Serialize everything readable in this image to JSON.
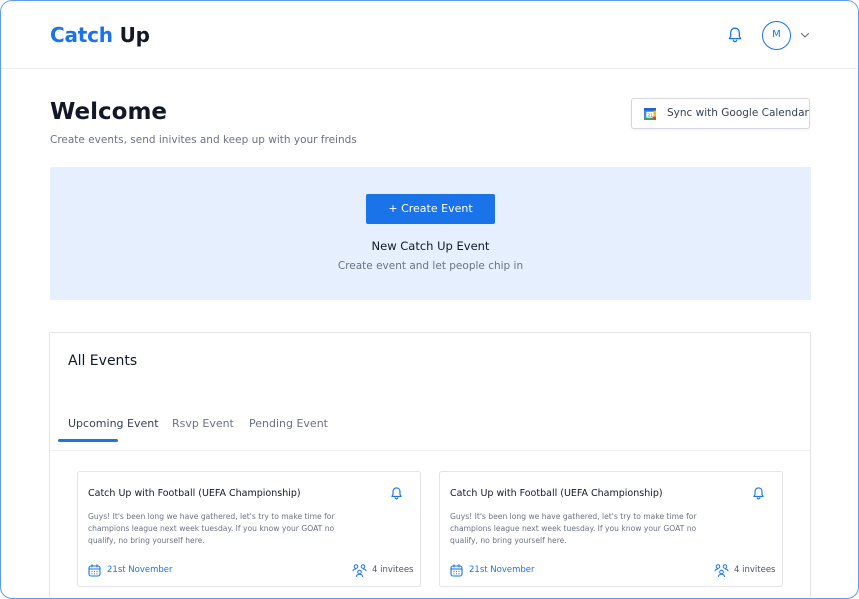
{
  "app": {
    "logo_accent": "Catch",
    "logo_rest": "Up",
    "avatar_initial": "M",
    "accent_color": "#1a73e8"
  },
  "welcome": {
    "title": "Welcome",
    "subtitle": "Create events, send inivites and keep up with your freinds",
    "sync_label": "Sync with Google Calendar"
  },
  "banner": {
    "button_label": "+ Create Event",
    "title": "New Catch Up Event",
    "subtitle": "Create event and let people chip in"
  },
  "events": {
    "title": "All Events",
    "tabs": [
      {
        "label": "Upcoming Event",
        "active": true
      },
      {
        "label": "Rsvp Event",
        "active": false
      },
      {
        "label": "Pending Event",
        "active": false
      }
    ],
    "cards": [
      {
        "title": "Catch Up with Football (UEFA Championship)",
        "description": "Guys! It's been long we have gathered, let's try to make time for champions league next week tuesday. If you know your GOAT no qualify, no bring yourself here.",
        "date": "21st November",
        "invitees": "4 invitees"
      },
      {
        "title": "Catch Up with Football (UEFA Championship)",
        "description": "Guys! It's been long we have gathered, let's try to make time for champions league next week tuesday. If you know your GOAT no qualify, no bring yourself here.",
        "date": "21st November",
        "invitees": "4 invitees"
      }
    ]
  },
  "icons": [
    "bell-icon",
    "chevron-down-icon",
    "google-calendar-icon",
    "calendar-icon",
    "people-icon"
  ]
}
